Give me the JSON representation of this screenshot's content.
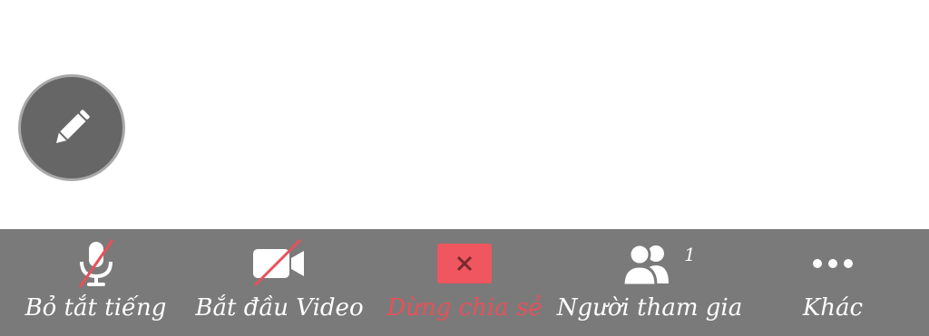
{
  "annotate": {
    "icon": "pencil-icon"
  },
  "toolbar": {
    "items": [
      {
        "id": "mute",
        "label": "Bỏ tắt tiếng",
        "icon": "microphone-muted-icon"
      },
      {
        "id": "video",
        "label": "Bắt đầu Video",
        "icon": "video-camera-off-icon"
      },
      {
        "id": "share",
        "label": "Dừng chia sẻ",
        "icon": "stop-share-icon"
      },
      {
        "id": "participants",
        "label": "Người tham gia",
        "icon": "participants-icon",
        "count": "1"
      },
      {
        "id": "more",
        "label": "Khác",
        "icon": "more-dots-icon"
      }
    ]
  },
  "colors": {
    "toolbar_bg": "#7a7a7a",
    "danger": "#e8505a",
    "fab_bg": "#666666"
  }
}
